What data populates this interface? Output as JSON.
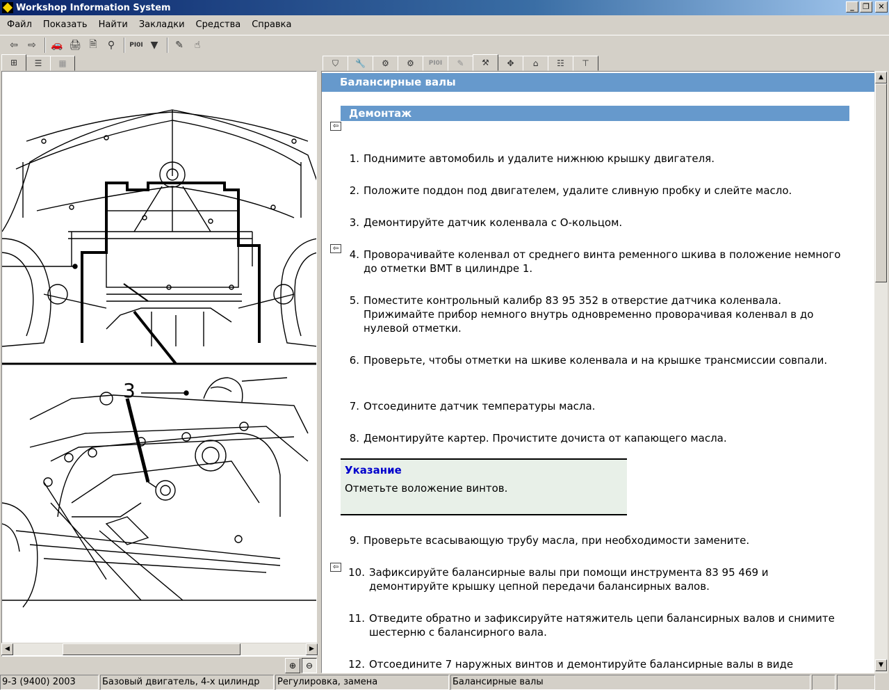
{
  "window": {
    "title": "Workshop Information System"
  },
  "menu": [
    "Файл",
    "Показать",
    "Найти",
    "Закладки",
    "Средства",
    "Справка"
  ],
  "toolbar": {
    "pi_label": "PI0I"
  },
  "right_tabs": {
    "pi_label": "PI0I"
  },
  "document": {
    "title": "Балансирные валы",
    "section": "Демонтаж",
    "steps": [
      {
        "num": "1.",
        "text": "Поднимите автомобиль и удалите нижнюю крышку двигателя."
      },
      {
        "num": "2.",
        "text": "Положите поддон под двигателем, удалите сливную пробку и слейте масло."
      },
      {
        "num": "3.",
        "text": "Демонтируйте датчик коленвала с О-кольцом."
      },
      {
        "num": "4.",
        "text": "Проворачивайте коленвал от среднего винта ременного шкива в положение немного до отметки ВМТ в цилиндре 1."
      },
      {
        "num": "5.",
        "text": "Поместите контрольный калибр 83 95 352 в отверстие датчика коленвала. Прижимайте прибор немного внутрь одновременно проворачивая коленвал в до нулевой отметки."
      },
      {
        "num": "6.",
        "text": "Проверьте, чтобы отметки на шкиве коленвала и на крышке трансмиссии совпали."
      },
      {
        "num": "7.",
        "text": "Отсоедините датчик температуры масла."
      },
      {
        "num": "8.",
        "text": "Демонтируйте картер. Прочистите дочиста от капающего масла."
      },
      {
        "num": "9.",
        "text": "Проверьте всасывающую трубу масла, при необходимости замените."
      },
      {
        "num": "10.",
        "text": "Зафиксируйте балансирные валы при помощи инструмента 83 95 469 и демонтируйте крышку цепной передачи балансирных валов."
      },
      {
        "num": "11.",
        "text": "Отведите обратно и зафиксируйте натяжитель цепи балансирных валов и снимите шестерню с балансирного вала."
      },
      {
        "num": "12.",
        "text": "Отсоедините 7 наружных винтов и демонтируйте балансирные валы в виде"
      }
    ],
    "note": {
      "title": "Указание",
      "text": "Отметьте воложение винтов."
    }
  },
  "illustration": {
    "callout": "3"
  },
  "status": [
    "9-3 (9400) 2003",
    "Базовый двигатель, 4-х цилиндр",
    "Регулировка, замена",
    "Балансирные валы"
  ]
}
